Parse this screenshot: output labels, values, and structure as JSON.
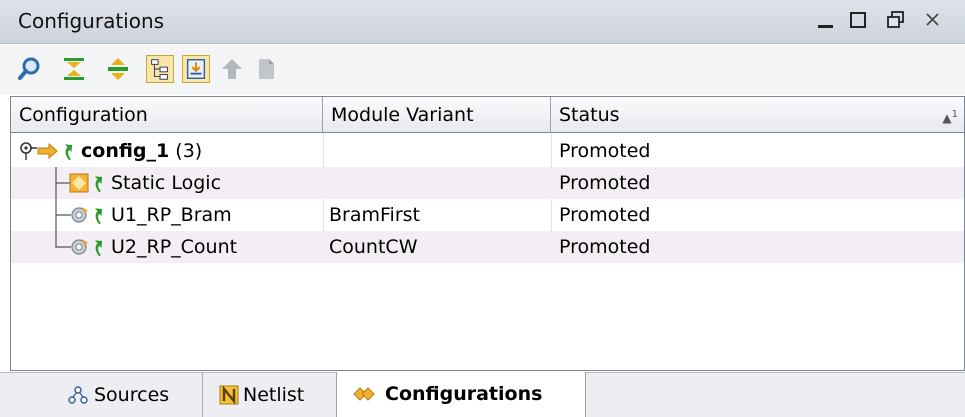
{
  "window": {
    "title": "Configurations",
    "controls": [
      "minimize-icon",
      "maximize-icon",
      "restore-icon",
      "close-icon"
    ]
  },
  "toolbar": {
    "buttons": [
      {
        "name": "search-icon",
        "toggled": false
      },
      {
        "name": "collapse-all-icon",
        "toggled": false
      },
      {
        "name": "expand-all-icon",
        "toggled": false
      },
      {
        "name": "hierarchy-view-icon",
        "toggled": true
      },
      {
        "name": "auto-scroll-icon",
        "toggled": true
      },
      {
        "name": "promote-icon",
        "toggled": false
      },
      {
        "name": "document-icon",
        "toggled": false
      }
    ]
  },
  "table": {
    "columns": [
      "Configuration",
      "Module Variant",
      "Status"
    ],
    "sort_indicator": "1",
    "rows": [
      {
        "name": "config_1",
        "count": "(3)",
        "variant": "",
        "status": "Promoted",
        "level": 0,
        "icon": "configuration-icon"
      },
      {
        "name": "Static Logic",
        "count": "",
        "variant": "",
        "status": "Promoted",
        "level": 1,
        "icon": "static-logic-icon"
      },
      {
        "name": "U1_RP_Bram",
        "count": "",
        "variant": "BramFirst",
        "status": "Promoted",
        "level": 1,
        "icon": "partition-icon"
      },
      {
        "name": "U2_RP_Count",
        "count": "",
        "variant": "CountCW",
        "status": "Promoted",
        "level": 1,
        "icon": "partition-icon"
      }
    ]
  },
  "tabs": [
    {
      "label": "Sources",
      "icon": "sources-icon",
      "active": false
    },
    {
      "label": "Netlist",
      "icon": "netlist-icon",
      "active": false
    },
    {
      "label": "Configurations",
      "icon": "configurations-icon",
      "active": true
    }
  ],
  "colors": {
    "promote_arrow": "#2a9a2a",
    "config_arrow": "#f0a020",
    "alt_row": "#f3eef3",
    "toggled_button": "#f8e6a6"
  }
}
